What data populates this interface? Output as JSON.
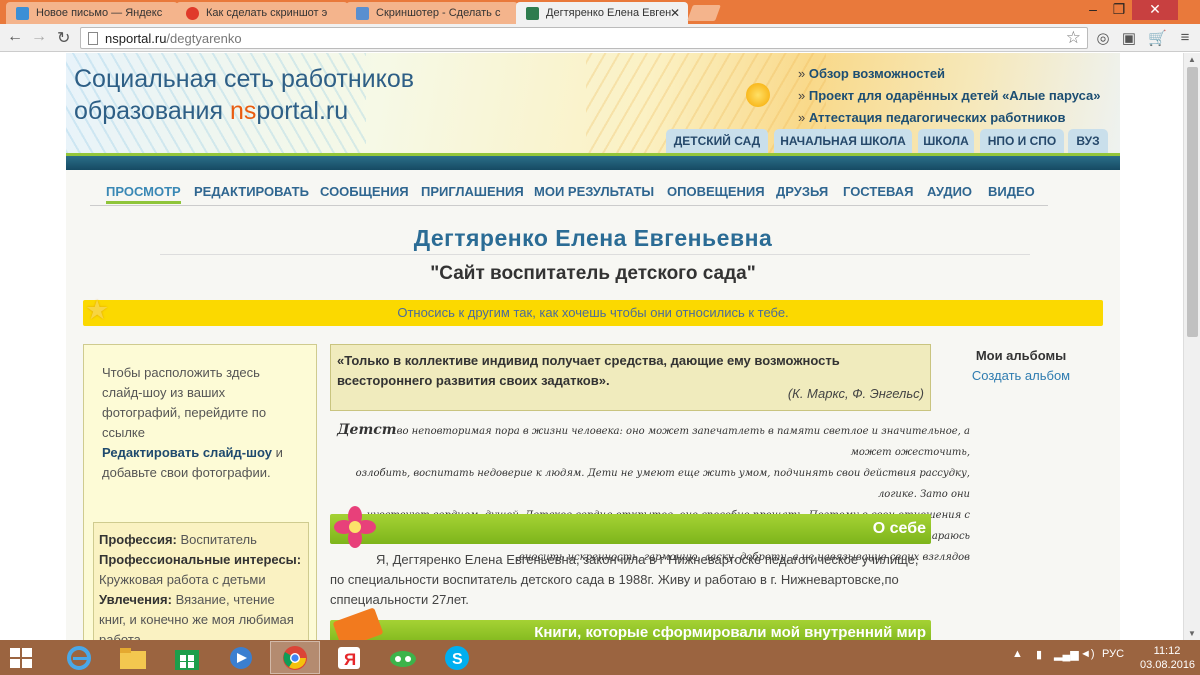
{
  "browser": {
    "tabs": [
      {
        "title": "Новое письмо — Яндекс",
        "icon": "mail-icon",
        "color": "#3b8fd6"
      },
      {
        "title": "Как сделать скриншот э",
        "icon": "yandex-icon",
        "color": "#e03a2a"
      },
      {
        "title": "Скриншотер - Сделать с",
        "icon": "document-icon",
        "color": "#5a8fd0"
      },
      {
        "title": "Дегтяренко Елена Евген",
        "icon": "nsportal-icon",
        "color": "#2e7c4e"
      }
    ],
    "url_host": "nsportal.ru",
    "url_path": "/degtyarenko"
  },
  "header": {
    "title_line1": "Социальная сеть работников",
    "title_line2_prefix": "образования ",
    "title_brand_ns": "ns",
    "title_brand_rest": "portal.ru",
    "links": [
      "Обзор возможностей",
      "Проект для одарённых детей «Алые паруса»",
      "Аттестация педагогических работников"
    ],
    "level_tabs": [
      "ДЕТСКИЙ САД",
      "НАЧАЛЬНАЯ ШКОЛА",
      "ШКОЛА",
      "НПО И СПО",
      "ВУЗ"
    ]
  },
  "user_nav": {
    "items": [
      "ПРОСМОТР",
      "РЕДАКТИРОВАТЬ",
      "СООБЩЕНИЯ",
      "ПРИГЛАШЕНИЯ",
      "МОИ РЕЗУЛЬТАТЫ",
      "ОПОВЕЩЕНИЯ",
      "ДРУЗЬЯ",
      "ГОСТЕВАЯ",
      "АУДИО",
      "ВИДЕО"
    ],
    "active": "ПРОСМОТР"
  },
  "profile": {
    "name": "Дегтяренко Елена Евгеньевна",
    "site_name": "\"Сайт воспитатель детского сада\"",
    "motto": "Относись к другим так, как хочешь чтобы они относились к тебе.",
    "slideshow_text_1": "Чтобы расположить здесь слайд-шоу из ваших фотографий, перейдите по ссылке",
    "slideshow_link": "Редактировать слайд-шоу",
    "slideshow_text_2": " и добавьте свои фотографии.",
    "profession_label": "Профессия:",
    "profession_value": " Воспитатель",
    "interests_label": "Профессиональные интересы:",
    "interests_value": " Кружковая работа с детьми",
    "hobbies_label": "Увлечения:",
    "hobbies_value": " Вязание, чтение книг, и конечно же моя любимая работа"
  },
  "quote": {
    "text": "«Только в коллективе индивид получает средства, дающие ему возможность всестороннего развития своих задатков».",
    "author": "(К. Маркс, Ф. Энгельс)"
  },
  "childhood": {
    "first_word": "Детст",
    "line1": "во неповторимая пора в жизни человека: оно может запечатлеть в памяти светлое и значительное, а может ожесточить,",
    "line2": "озлобить, воспитать недоверие к людям. Дети не умеют еще жить умом, подчинять свои действия рассудку, логике. Зато они",
    "line3": "чувствуют сердцем, душой. Детское сердце открытое, оно способно прощать. Поэтому в свои отношения с детьми я стараюсь",
    "line4": ".вносить искренность, гармонию, ласку, доброту, а не навязывание своих взглядов"
  },
  "sections": {
    "about_title": "О себе",
    "about_text": "Я, Дегтяренко Елена Евгеньевна, закончила в г Нижневартоске педагогическое училище, по специальности воспитатель детского сада в 1988г. Живу и работаю  в г. Нижневартовске,по сппециальности 27лет.",
    "books_title": "Книги, которые сформировали мой внутренний мир"
  },
  "albums": {
    "heading": "Мои альбомы",
    "create_link": "Создать альбом"
  },
  "taskbar": {
    "apps": [
      "ie-icon",
      "file-explorer-icon",
      "store-icon",
      "media-icon",
      "chrome-icon",
      "yandex-browser-icon",
      "cloud-icon",
      "skype-icon"
    ],
    "active_app": "chrome-icon",
    "language": "РУС",
    "time": "11:12",
    "date": "03.08.2016"
  },
  "colors": {
    "titlebar": "#e9793b",
    "accent_green": "#8fc53a",
    "motto_yellow": "#fbd900",
    "link_blue": "#2f6690",
    "taskbar": "#9b6440"
  }
}
